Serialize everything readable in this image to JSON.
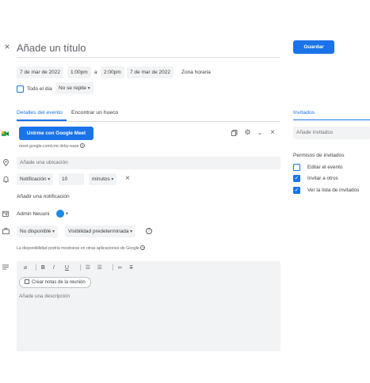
{
  "header": {
    "close_icon": "×",
    "title_placeholder": "Añade un título",
    "save_label": "Guardar"
  },
  "datetime": {
    "start_date": "7 de mar de 2022",
    "start_time": "1:00pm",
    "separator": "a",
    "end_time": "2:00pm",
    "end_date": "7 de mar de 2022",
    "timezone": "Zona horaria",
    "all_day": "Todo el día",
    "repeat": "No se repite"
  },
  "tabs": {
    "details": "Detalles del evento",
    "find_slot": "Encontrar un hueco"
  },
  "meet": {
    "button_label": "Unirme con Google Meet",
    "link": "meet.google.com/cmc-brby-ease",
    "icons": [
      "copy-icon",
      "gear-icon",
      "chevron-down-icon",
      "close-icon"
    ]
  },
  "location": {
    "placeholder": "Añade una ubicación"
  },
  "notification": {
    "type": "Notificación",
    "value": "10",
    "unit": "minutos",
    "add": "Añadir una notificación"
  },
  "calendar": {
    "owner": "Admin Neuuni",
    "color": "#1e88e5"
  },
  "availability": {
    "status": "No disponible",
    "visibility": "Visibilidad predeterminada",
    "note": "La disponibilidad podría mostrarse en otras aplicaciones de Google"
  },
  "editor": {
    "toolbar": [
      "attach-icon",
      "bold-icon",
      "italic-icon",
      "underline-icon",
      "numbered-list-icon",
      "bulleted-list-icon",
      "link-icon",
      "clear-format-icon"
    ],
    "notes_button": "Crear notas de la reunión",
    "description_placeholder": "Añade una descripción"
  },
  "guests": {
    "tab": "Invitados",
    "placeholder": "Añade invitados",
    "permissions_title": "Permisos de invitados",
    "permissions": [
      {
        "label": "Editar el evento",
        "checked": false
      },
      {
        "label": "Invitar a otros",
        "checked": true
      },
      {
        "label": "Ver la lista de invitados",
        "checked": true
      }
    ]
  },
  "colors": {
    "accent": "#1a73e8",
    "field_bg": "#f1f3f4",
    "meet_green": "#34a853"
  }
}
